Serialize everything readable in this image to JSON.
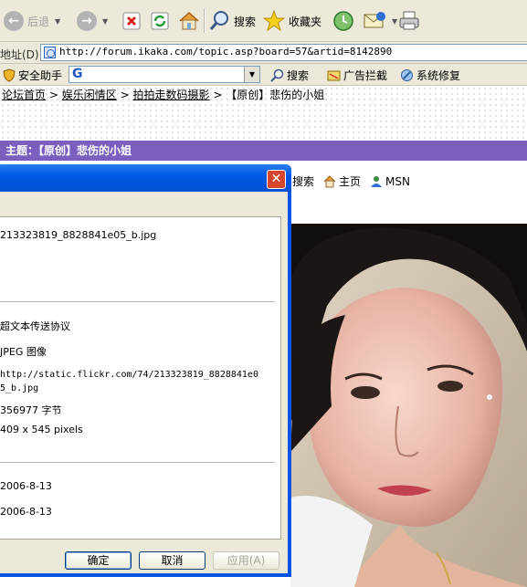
{
  "toolbar": {
    "back_label": "后退",
    "search_label": "搜索",
    "favorites_label": "收藏夹"
  },
  "address": {
    "label": "地址(D)",
    "url": "http://forum.ikaka.com/topic.asp?board=57&artid=8142890"
  },
  "helper_bar": {
    "assistant_label": "安全助手",
    "combo_value": "G",
    "search_label": "搜索",
    "adblock_label": "广告拦截",
    "repair_label": "系统修复"
  },
  "page": {
    "breadcrumb": [
      "论坛首页",
      "娱乐闲情区",
      "拍拍走数码摄影",
      "【原创】悲伤的小姐"
    ],
    "breadcrumb_sep": ">",
    "topic_title": "主题：【原创】悲伤的小姐",
    "post_toolbar": [
      "搜索",
      "主页",
      "MSN"
    ]
  },
  "dialog": {
    "close_glyph": "✕",
    "filename": "213323819_8828841e05_b.jpg",
    "protocol": "超文本传送协议",
    "type": "JPEG 图像",
    "address_line1": "http://static.flickr.com/74/213323819_8828841e0",
    "address_line2": "5_b.jpg",
    "size": "356977 字节",
    "dimensions": "409  x  545  pixels",
    "created": "2006-8-13",
    "modified": "2006-8-13",
    "buttons": {
      "ok": "确定",
      "cancel": "取消",
      "apply": "应用(A)"
    }
  },
  "colors": {
    "topic_bar": "#7b5fbf",
    "xp_titlebar": "#0058e6",
    "xp_close": "#d5462c"
  },
  "icons": [
    "back-arrow-icon",
    "forward-arrow-icon",
    "stop-icon",
    "refresh-icon",
    "home-icon",
    "search-magnifier-icon",
    "favorites-star-icon",
    "history-icon",
    "mail-icon",
    "print-icon",
    "page-icon",
    "shield-icon",
    "adblock-icon",
    "repair-icon",
    "msn-user-icon"
  ]
}
